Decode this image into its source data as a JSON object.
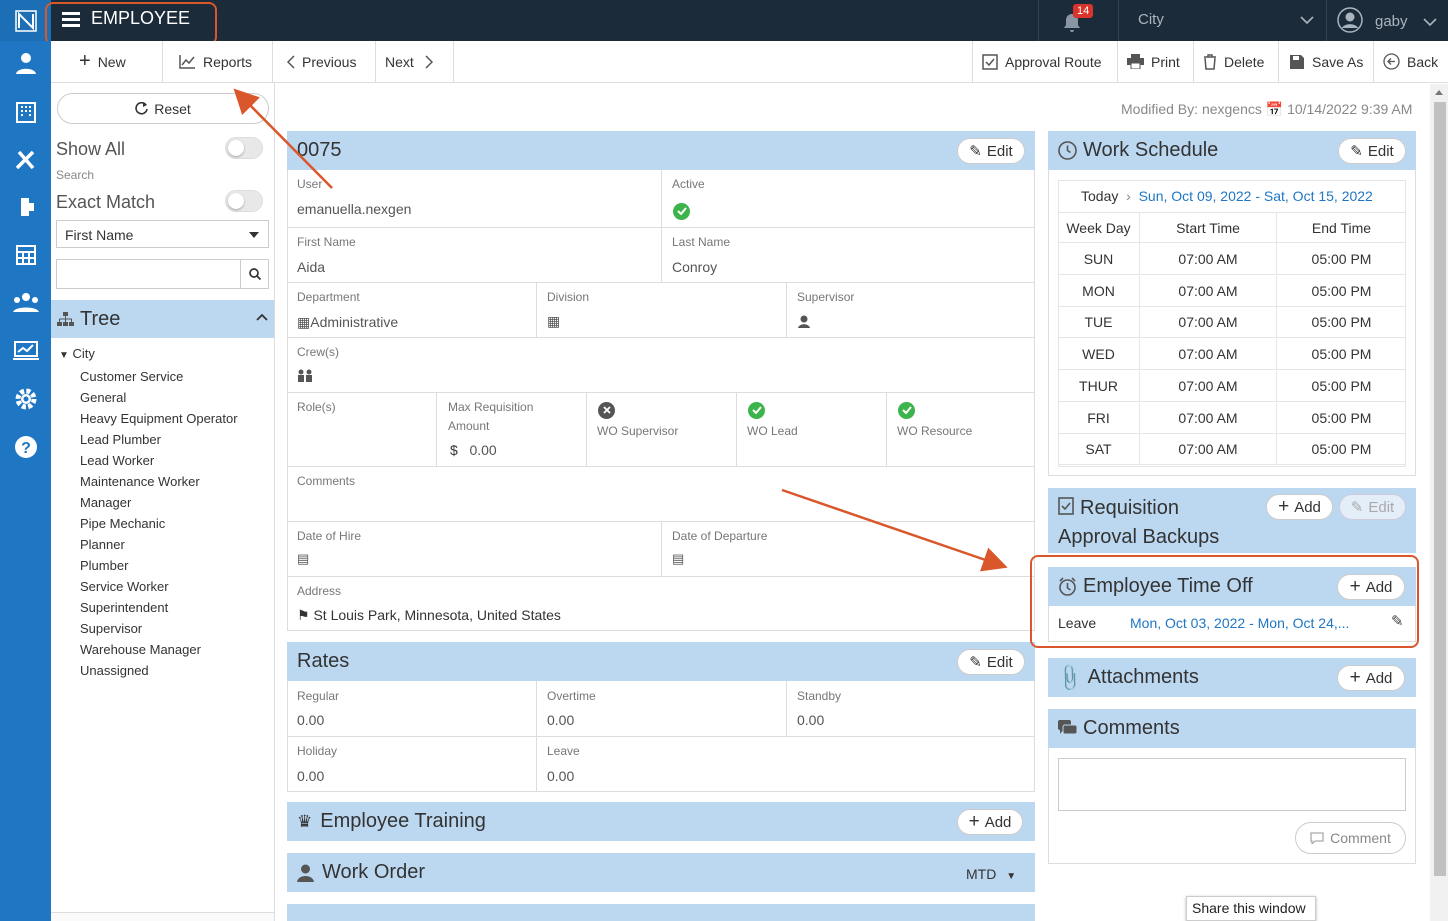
{
  "app": {
    "module_title": "EMPLOYEE",
    "notification_count": "14",
    "location": "City",
    "user": "gaby"
  },
  "toolbar": {
    "new": "New",
    "reports": "Reports",
    "previous": "Previous",
    "next": "Next",
    "approval_route": "Approval Route",
    "print": "Print",
    "delete": "Delete",
    "save_as": "Save As",
    "back": "Back"
  },
  "sidebar": {
    "reset": "Reset",
    "show_all": "Show All",
    "search_label": "Search",
    "exact_match": "Exact Match",
    "field_select": "First Name",
    "search_value": "",
    "tree_title": "Tree",
    "tree_root": "City",
    "tree_items": [
      "Customer Service",
      "General",
      "Heavy Equipment Operator",
      "Lead Plumber",
      "Lead Worker",
      "Maintenance Worker",
      "Manager",
      "Pipe Mechanic",
      "Planner",
      "Plumber",
      "Service Worker",
      "Superintendent",
      "Supervisor",
      "Warehouse Manager",
      "Unassigned"
    ]
  },
  "modified": {
    "label": "Modified By:",
    "by": "nexgencs",
    "date": "10/14/2022 9:39 AM"
  },
  "employee": {
    "id": "0075",
    "edit": "Edit",
    "user_label": "User",
    "user": "emanuella.nexgen",
    "active_label": "Active",
    "first_name_label": "First Name",
    "first_name": "Aida",
    "last_name_label": "Last Name",
    "last_name": "Conroy",
    "department_label": "Department",
    "department": "Administrative",
    "division_label": "Division",
    "supervisor_label": "Supervisor",
    "crews_label": "Crew(s)",
    "roles_label": "Role(s)",
    "max_req_label1": "Max Requisition",
    "max_req_label2": "Amount",
    "max_req_currency": "$",
    "max_req": "0.00",
    "wo_supervisor": "WO Supervisor",
    "wo_lead": "WO Lead",
    "wo_resource": "WO Resource",
    "comments_label": "Comments",
    "hire_label": "Date of Hire",
    "departure_label": "Date of Departure",
    "address_label": "Address",
    "address": "St Louis Park, Minnesota, United States"
  },
  "rates": {
    "title": "Rates",
    "edit": "Edit",
    "regular_label": "Regular",
    "regular": "0.00",
    "overtime_label": "Overtime",
    "overtime": "0.00",
    "standby_label": "Standby",
    "standby": "0.00",
    "holiday_label": "Holiday",
    "holiday": "0.00",
    "leave_label": "Leave",
    "leave": "0.00"
  },
  "training": {
    "title": "Employee Training",
    "add": "Add"
  },
  "work_order": {
    "title": "Work Order",
    "period": "MTD"
  },
  "schedule": {
    "title": "Work Schedule",
    "edit": "Edit",
    "today": "Today",
    "range": "Sun, Oct 09, 2022 - Sat, Oct 15, 2022",
    "col_day": "Week Day",
    "col_start": "Start Time",
    "col_end": "End Time",
    "rows": [
      {
        "day": "SUN",
        "start": "07:00 AM",
        "end": "05:00 PM"
      },
      {
        "day": "MON",
        "start": "07:00 AM",
        "end": "05:00 PM"
      },
      {
        "day": "TUE",
        "start": "07:00 AM",
        "end": "05:00 PM"
      },
      {
        "day": "WED",
        "start": "07:00 AM",
        "end": "05:00 PM"
      },
      {
        "day": "THUR",
        "start": "07:00 AM",
        "end": "05:00 PM"
      },
      {
        "day": "FRI",
        "start": "07:00 AM",
        "end": "05:00 PM"
      },
      {
        "day": "SAT",
        "start": "07:00 AM",
        "end": "05:00 PM"
      }
    ]
  },
  "req_backups": {
    "title1": "Requisition",
    "title2": "Approval Backups",
    "add": "Add",
    "edit": "Edit"
  },
  "time_off": {
    "title": "Employee Time Off",
    "add": "Add",
    "type": "Leave",
    "range": "Mon, Oct 03, 2022 - Mon, Oct 24,..."
  },
  "attachments": {
    "title": "Attachments",
    "add": "Add"
  },
  "comments": {
    "title": "Comments",
    "text": "",
    "button": "Comment"
  },
  "share": "Share this window",
  "colors": {
    "topbar": "#1c2b3a",
    "nav": "#1f77c4",
    "panel": "#bcd8f1",
    "accent": "#d9572b",
    "link": "#1f77c4",
    "success": "#3cb44b"
  }
}
